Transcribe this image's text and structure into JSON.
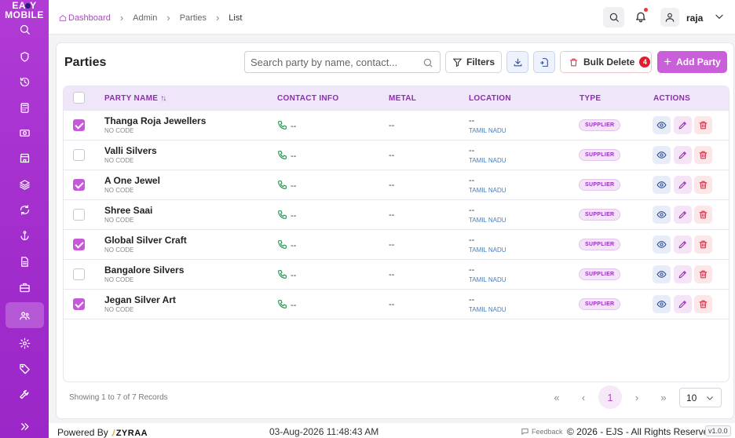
{
  "app": {
    "logo_line1": "EA",
    "logo_line1b": "Y",
    "logo_line2": "MOBILE"
  },
  "breadcrumb": {
    "items": [
      "Dashboard",
      "Admin",
      "Parties",
      "List"
    ]
  },
  "user": {
    "name": "raja"
  },
  "sidebar": {
    "icons": [
      "search-icon",
      "shield-icon",
      "history-icon",
      "calculator-icon",
      "cash-icon",
      "store-icon",
      "layers-icon",
      "refresh-icon",
      "anchor-icon",
      "document-icon",
      "briefcase-icon",
      "users-icon",
      "settings-icon",
      "tag-icon",
      "wrench-icon",
      "double-chevron-right-icon"
    ],
    "active": "users-icon"
  },
  "page": {
    "title": "Parties",
    "search_placeholder": "Search party by name, contact...",
    "filters_label": "Filters",
    "bulk_delete_label": "Bulk Delete",
    "bulk_delete_count": "4",
    "add_label": "Add Party"
  },
  "table": {
    "headers": [
      "PARTY NAME",
      "CONTACT INFO",
      "METAL",
      "LOCATION",
      "TYPE",
      "ACTIONS"
    ],
    "sort_indicator": "↑↓",
    "rows": [
      {
        "checked": true,
        "name": "Thanga Roja Jewellers",
        "code": "NO CODE",
        "contact": "--",
        "metal": "--",
        "location": "--",
        "state": "TAMIL NADU",
        "type": "SUPPLIER"
      },
      {
        "checked": false,
        "name": "Valli Silvers",
        "code": "NO CODE",
        "contact": "--",
        "metal": "--",
        "location": "--",
        "state": "TAMIL NADU",
        "type": "SUPPLIER"
      },
      {
        "checked": true,
        "name": "A One Jewel",
        "code": "NO CODE",
        "contact": "--",
        "metal": "--",
        "location": "--",
        "state": "TAMIL NADU",
        "type": "SUPPLIER"
      },
      {
        "checked": false,
        "name": "Shree Saai",
        "code": "NO CODE",
        "contact": "--",
        "metal": "--",
        "location": "--",
        "state": "TAMIL NADU",
        "type": "SUPPLIER"
      },
      {
        "checked": true,
        "name": "Global Silver Craft",
        "code": "NO CODE",
        "contact": "--",
        "metal": "--",
        "location": "--",
        "state": "TAMIL NADU",
        "type": "SUPPLIER"
      },
      {
        "checked": false,
        "name": "Bangalore Silvers",
        "code": "NO CODE",
        "contact": "--",
        "metal": "--",
        "location": "--",
        "state": "TAMIL NADU",
        "type": "SUPPLIER"
      },
      {
        "checked": true,
        "name": "Jegan Silver Art",
        "code": "NO CODE",
        "contact": "--",
        "metal": "--",
        "location": "--",
        "state": "TAMIL NADU",
        "type": "SUPPLIER"
      }
    ]
  },
  "pagination": {
    "summary": "Showing 1 to 7 of 7 Records",
    "current_page": "1",
    "per_page": "10",
    "first": "«",
    "prev": "‹",
    "next": "›",
    "last": "»"
  },
  "footer": {
    "powered_by": "Powered By",
    "brand": "ZYRAA",
    "datetime": "03-Aug-2026 11:48:43 AM",
    "feedback": "Feedback",
    "copyright": "© 2026 - EJS - All Rights Reserved.",
    "version": "v1.0.0"
  },
  "colors": {
    "sidebar": "#a12ccc",
    "accent": "#c95fd9",
    "header_bg": "#efe6f9",
    "danger": "#e01e2e"
  }
}
